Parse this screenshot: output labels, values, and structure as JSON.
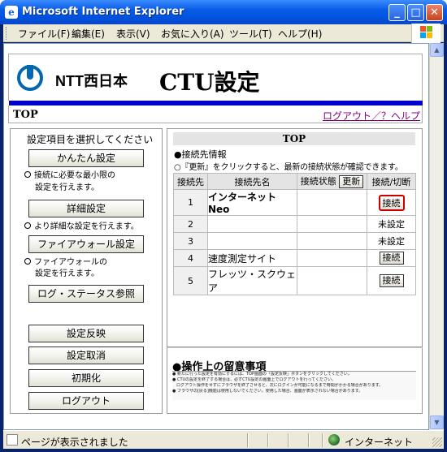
{
  "window": {
    "title": "Microsoft Internet Explorer",
    "min_label": "_",
    "max_label": "□",
    "close_label": "✕"
  },
  "menu": [
    "ファイル(F)",
    "編集(E)",
    "表示(V)",
    "お気に入り(A)",
    "ツール(T)",
    "ヘルプ(H)"
  ],
  "header": {
    "brand": "NTT西日本",
    "title": "CTU設定",
    "section": "TOP",
    "logout": "ログアウト",
    "separator": "／",
    "help": "？ヘルプ"
  },
  "sidebar": {
    "title": "設定項目を選択してください",
    "buttons": {
      "easy": "かんたん設定",
      "detail": "詳細設定",
      "firewall": "ファイアウォール設定",
      "log": "ログ・ステータス参照",
      "apply": "設定反映",
      "cancel": "設定取消",
      "init": "初期化",
      "logout": "ログアウト"
    },
    "notes": {
      "easy_1": "接続に必要な最小限の",
      "easy_2": "設定を行えます。",
      "detail_1": "より詳細な設定を行えます。",
      "fw_1": "ファイアウォールの",
      "fw_2": "設定を行えます。"
    }
  },
  "main": {
    "title": "TOP",
    "info_head": "●接続先情報",
    "info_note": "○『更新』をクリックすると、最新の接続状態が確認できます。",
    "columns": {
      "no": "接続先",
      "name": "接続先名",
      "state": "接続状態",
      "refresh": "更新",
      "action": "接続/切断"
    },
    "rows": [
      {
        "no": "1",
        "name": "インターネットNeo",
        "action": "接続",
        "type": "button"
      },
      {
        "no": "2",
        "name": "",
        "action": "未設定",
        "type": "text"
      },
      {
        "no": "3",
        "name": "",
        "action": "未設定",
        "type": "text"
      },
      {
        "no": "4",
        "name": "速度測定サイト",
        "action": "接続",
        "type": "button"
      },
      {
        "no": "5",
        "name": "フレッツ・スクウェア",
        "action": "接続",
        "type": "button"
      }
    ]
  },
  "notice": {
    "title": "●操作上の留意事項",
    "lines": [
      "● 新たに行った設定を有効にするには、TOP画面の「設定反映」ボタンをクリックしてください。",
      "● CTUの設定を終了する場合は、必ずCTU設定の画面上でログアウトを行ってください。",
      "　ログアウト操作をせずにブラウザを終了させると、次にログインが可能になるまで時間がかかる場合があります。",
      "● ブラウザの[戻る]機能は使用しないでください。使用した場合、画面が表示されない場合があります。"
    ]
  },
  "status": {
    "text": "ページが表示されました",
    "zone": "インターネット"
  },
  "colors": {
    "titlebar": "#0a5ce8",
    "blue_bar": "#0000cc",
    "link": "#800080",
    "highlight": "#cc0000",
    "ntt_blue": "#0067b0"
  }
}
